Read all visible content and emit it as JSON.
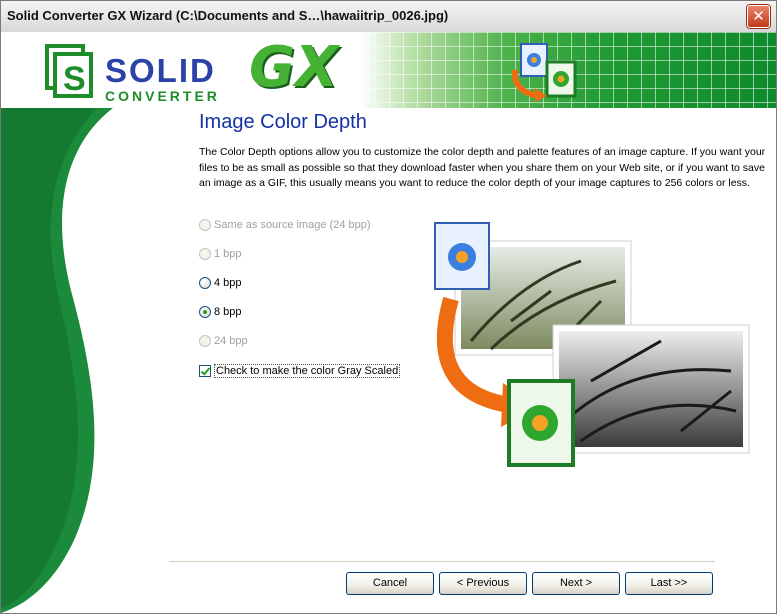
{
  "window": {
    "title": "Solid Converter GX Wizard (C:\\Documents and S…\\hawaiitrip_0026.jpg)",
    "close_glyph": "✕"
  },
  "banner": {
    "logo_solid": "SOLID",
    "logo_converter": "CONVERTER",
    "logo_gx": "GX",
    "accent_green": "#1f9a33",
    "accent_blue": "#2b43a6"
  },
  "page": {
    "title": "Image Color Depth",
    "description": "The Color Depth options allow you to customize the color depth and palette features of an image capture. If you want your files to be as small as possible so that they download faster when you share them on your Web site, or if you want to save an image as a GIF, this usually means you want to reduce the color depth of your image captures to 256 colors or less."
  },
  "options": [
    {
      "label": "Same as source image (24 bpp)",
      "enabled": false,
      "selected": false
    },
    {
      "label": "1 bpp",
      "enabled": false,
      "selected": false
    },
    {
      "label": "4 bpp",
      "enabled": true,
      "selected": false
    },
    {
      "label": "8 bpp",
      "enabled": true,
      "selected": true
    },
    {
      "label": "24 bpp",
      "enabled": false,
      "selected": false
    }
  ],
  "grayscale": {
    "label": "Check to make the color Gray Scaled",
    "checked": true
  },
  "buttons": {
    "cancel": "Cancel",
    "previous": "< Previous",
    "next": "Next >",
    "last": "Last >>"
  }
}
